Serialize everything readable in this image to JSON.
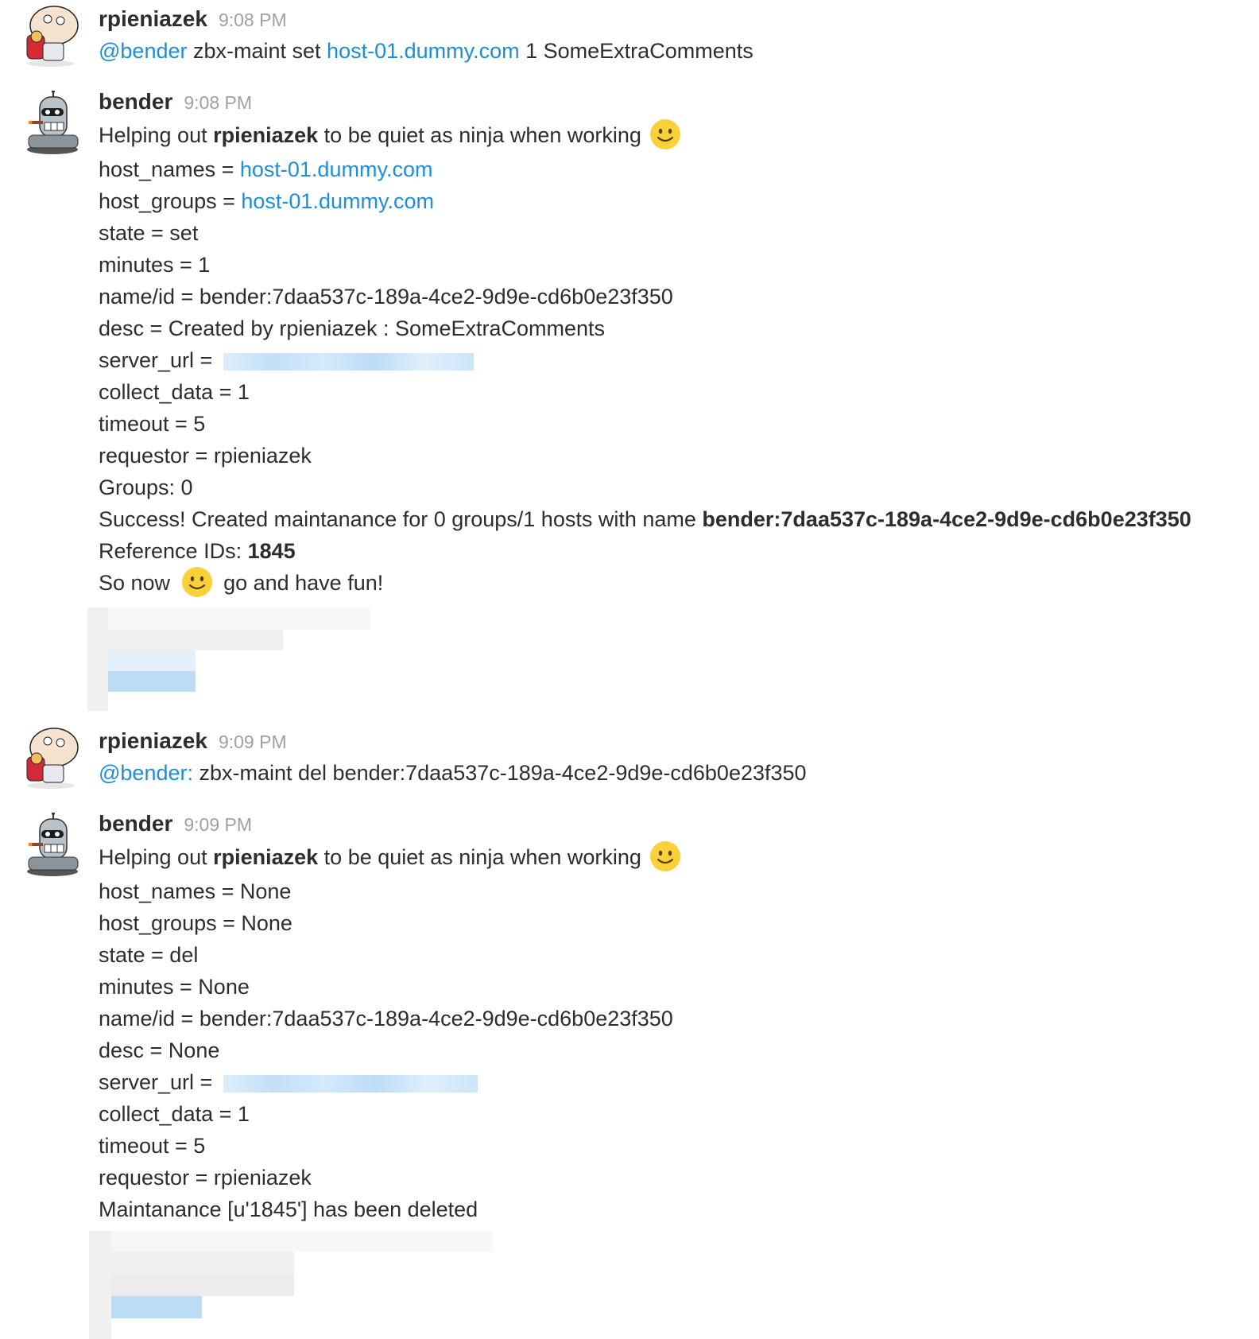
{
  "colors": {
    "link": "#1d8ed8",
    "username": "#2c2d30",
    "timestamp": "#a0a0a2",
    "text": "#2c2d30"
  },
  "messages": [
    {
      "author": "rpieniazek",
      "avatar_icon": "stewie-avatar-icon",
      "time": "9:08 PM",
      "mention": "@bender",
      "text_a": " zbx-maint set ",
      "link": "host-01.dummy.com",
      "text_b": " 1 SomeExtraComments"
    },
    {
      "author": "bender",
      "avatar_icon": "bender-avatar-icon",
      "time": "9:08 PM",
      "intro_a": "Helping out ",
      "intro_user": "rpieniazek",
      "intro_b": " to be quiet as ninja when working",
      "host_names_label": "host_names = ",
      "host_names_value": "host-01.dummy.com",
      "host_groups_label": "host_groups = ",
      "host_groups_value": "host-01.dummy.com",
      "state": "state = set",
      "minutes": "minutes = 1",
      "name_id": "name/id = bender:7daa537c-189a-4ce2-9d9e-cd6b0e23f350",
      "desc": "desc = Created by rpieniazek : SomeExtraComments",
      "server_url_label": "server_url = ",
      "collect_data": "collect_data = 1",
      "timeout": "timeout = 5",
      "requestor": "requestor = rpieniazek",
      "groups": "Groups: 0",
      "success_a": "Success! Created maintanance for 0 groups/1 hosts with name ",
      "success_name": "bender:7daa537c-189a-4ce2-9d9e-cd6b0e23f350",
      "ref_label": "Reference IDs: ",
      "ref_value": "1845",
      "sonow_a": "So now ",
      "sonow_b": " go and have fun!"
    },
    {
      "author": "rpieniazek",
      "avatar_icon": "stewie-avatar-icon",
      "time": "9:09 PM",
      "mention": "@bender:",
      "text_a": " zbx-maint del bender:7daa537c-189a-4ce2-9d9e-cd6b0e23f350"
    },
    {
      "author": "bender",
      "avatar_icon": "bender-avatar-icon",
      "time": "9:09 PM",
      "intro_a": "Helping out ",
      "intro_user": "rpieniazek",
      "intro_b": " to be quiet as ninja when working",
      "host_names": "host_names = None",
      "host_groups": "host_groups = None",
      "state": "state = del",
      "minutes": "minutes = None",
      "name_id": "name/id = bender:7daa537c-189a-4ce2-9d9e-cd6b0e23f350",
      "desc": "desc = None",
      "server_url_label": "server_url = ",
      "collect_data": "collect_data = 1",
      "timeout": "timeout = 5",
      "requestor": "requestor = rpieniazek",
      "deleted": "Maintanance [u'1845'] has been deleted"
    }
  ]
}
